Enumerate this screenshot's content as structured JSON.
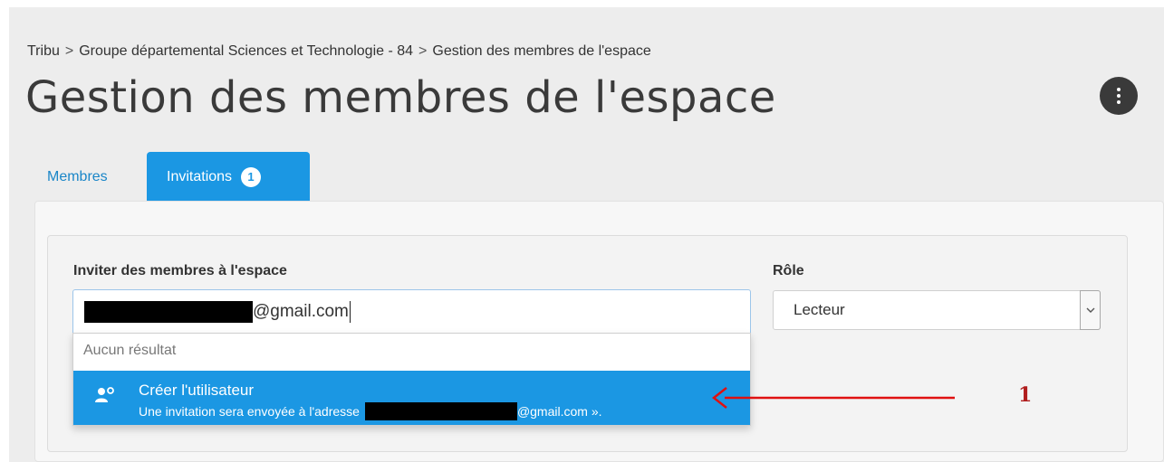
{
  "breadcrumb": {
    "items": [
      "Tribu",
      "Groupe départemental Sciences et Technologie - 84",
      "Gestion des membres de l'espace"
    ],
    "separator": ">"
  },
  "header": {
    "title": "Gestion des membres de l'espace",
    "more_icon": "vertical-dots-icon"
  },
  "tabs": {
    "members": {
      "label": "Membres"
    },
    "invitations": {
      "label": "Invitations",
      "badge": "1"
    }
  },
  "invite": {
    "label": "Inviter des membres à l'espace",
    "value_suffix": "@gmail.com",
    "no_result": "Aucun résultat",
    "suggestion": {
      "icon": "add-user-icon",
      "title": "Créer l'utilisateur",
      "subtitle_prefix": "Une invitation sera envoyée à l'adresse",
      "subtitle_suffix": "@gmail.com »."
    }
  },
  "role": {
    "label": "Rôle",
    "value": "Lecteur"
  },
  "annotation": {
    "number": "1"
  },
  "colors": {
    "accent": "#1b97e3",
    "annotation": "#e01010",
    "page_bg": "#ededed"
  }
}
